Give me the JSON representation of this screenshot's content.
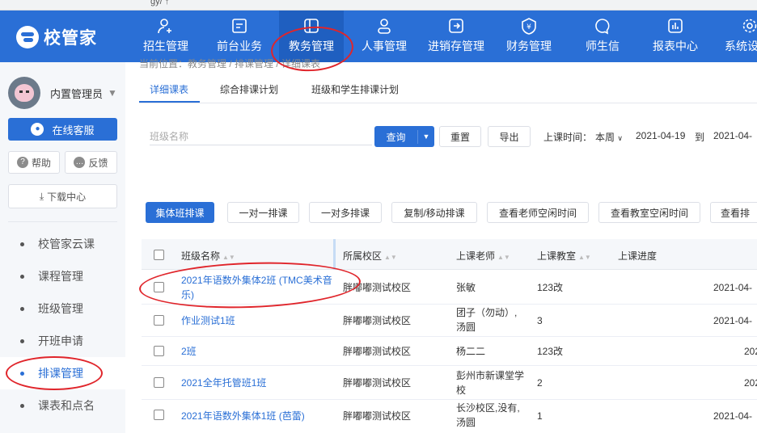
{
  "browser": {
    "url_fragment": "gy/ ↑"
  },
  "topnav": {
    "logo_text": "校管家",
    "items": [
      {
        "label": "招生管理",
        "icon": "user-add-icon"
      },
      {
        "label": "前台业务",
        "icon": "monitor-icon"
      },
      {
        "label": "教务管理",
        "icon": "book-icon"
      },
      {
        "label": "人事管理",
        "icon": "person-icon"
      },
      {
        "label": "进销存管理",
        "icon": "exchange-icon"
      },
      {
        "label": "财务管理",
        "icon": "yen-shield-icon"
      },
      {
        "label": "师生信",
        "icon": "chat-icon"
      },
      {
        "label": "报表中心",
        "icon": "chart-icon"
      },
      {
        "label": "系统设",
        "icon": "gear-icon"
      }
    ],
    "active_index": 2
  },
  "sidebar": {
    "user_name": "内置管理员",
    "service_label": "在线客服",
    "help_label": "帮助",
    "feedback_label": "反馈",
    "download_label": "下载中心",
    "menu": [
      {
        "label": "校管家云课"
      },
      {
        "label": "课程管理"
      },
      {
        "label": "班级管理"
      },
      {
        "label": "开班申请"
      },
      {
        "label": "排课管理"
      },
      {
        "label": "课表和点名"
      }
    ],
    "active_index": 4
  },
  "breadcrumb": "当前位置：教务管理 / 排课管理 / 详细课表",
  "tabs": [
    {
      "label": "详细课表"
    },
    {
      "label": "综合排课计划"
    },
    {
      "label": "班级和学生排课计划"
    }
  ],
  "filters": {
    "class_name_placeholder": "班级名称",
    "query_label": "查询",
    "reset_label": "重置",
    "export_label": "导出",
    "time_label": "上课时间：",
    "period_value": "本周",
    "date_start": "2021-04-19",
    "date_to": "到",
    "date_end": "2021-04-"
  },
  "actions": {
    "group_schedule": "集体班排课",
    "one_to_one": "一对一排课",
    "one_to_many": "一对多排课",
    "copy_move": "复制/移动排课",
    "teacher_free": "查看老师空闲时间",
    "room_free": "查看教室空闲时间",
    "more": "查看排"
  },
  "table": {
    "headers": {
      "class_name": "班级名称",
      "campus": "所属校区",
      "teacher": "上课老师",
      "room": "上课教室",
      "progress": "上课进度"
    },
    "rows": [
      {
        "class_name": "2021年语数外集体2班 (TMC美术音乐)",
        "campus": "胖嘟嘟测试校区",
        "teacher": "张敏",
        "room": "123改",
        "date": "2021-04-"
      },
      {
        "class_name": "作业测试1班",
        "campus": "胖嘟嘟测试校区",
        "teacher": "团子（勿动）,汤圆",
        "room": "3",
        "date": "2021-04-"
      },
      {
        "class_name": "2班",
        "campus": "胖嘟嘟测试校区",
        "teacher": "杨二二",
        "room": "123改",
        "date": "202"
      },
      {
        "class_name": "2021全年托管班1班",
        "campus": "胖嘟嘟测试校区",
        "teacher": "彭州市新课堂学校",
        "room": "2",
        "date": "202"
      },
      {
        "class_name": "2021年语数外集体1班 (芭蕾)",
        "campus": "胖嘟嘟测试校区",
        "teacher": "长沙校区,没有,汤圆",
        "room": "1",
        "date": "2021-04-"
      }
    ]
  },
  "colors": {
    "primary": "#2a6fd6",
    "annotation": "#e0252b"
  }
}
